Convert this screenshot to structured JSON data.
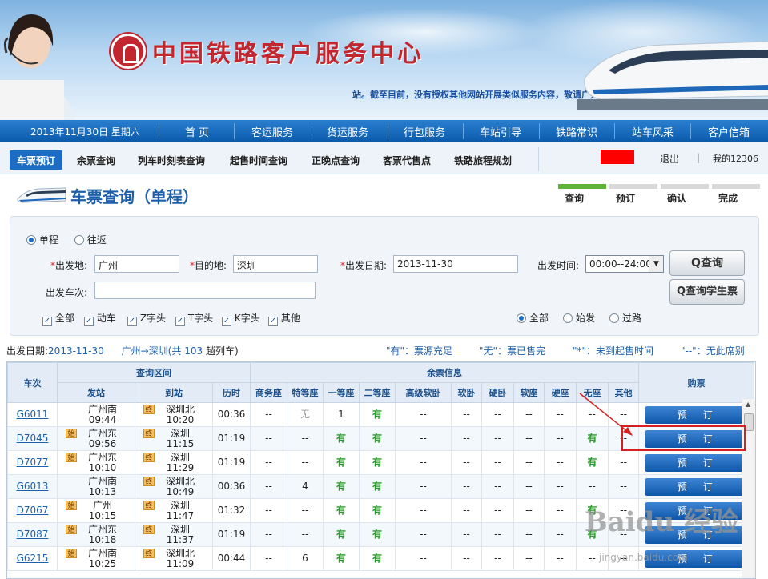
{
  "banner": {
    "title": "中国铁路客户服务中心",
    "note": "站。截至目前，没有授权其他网站开展类似服务内容，敬请广大用户注意"
  },
  "nav": {
    "date": "2013年11月30日 星期六",
    "items": [
      "首 页",
      "客运服务",
      "货运服务",
      "行包服务",
      "车站引导",
      "铁路常识",
      "站车风采",
      "客户信箱"
    ]
  },
  "subnav": {
    "tabs": [
      "车票预订",
      "余票查询",
      "列车时刻表查询",
      "起售时间查询",
      "正晚点查询",
      "客票代售点",
      "铁路旅程规划"
    ],
    "logout": "退出",
    "sep": "|",
    "my": "我的12306"
  },
  "page": {
    "title": "车票查询（单程）",
    "steps": [
      "查询",
      "预订",
      "确认",
      "完成"
    ]
  },
  "form": {
    "trip_oneway": "单程",
    "trip_round": "往返",
    "from_label": "出发地:",
    "from_value": "广州",
    "to_label": "目的地:",
    "to_value": "深圳",
    "date_label": "出发日期:",
    "date_value": "2013-11-30",
    "time_label": "出发时间:",
    "time_value": "00:00--24:00",
    "train_label": "出发车次:",
    "train_value": "",
    "req_mark": "*",
    "check_mark": "✓",
    "types": [
      "全部",
      "动车",
      "Z字头",
      "T字头",
      "K字头",
      "其他"
    ],
    "station_filter": [
      "全部",
      "始发",
      "过路"
    ],
    "query_btn": "查询",
    "student_btn": "查询学生票",
    "search_glyph": "Q"
  },
  "summary": {
    "label": "出发日期:",
    "date": "2013-11-30",
    "route": "广州→深圳(共",
    "count": "103",
    "unit": "趟列车)",
    "legend_you": "\"有\"：票源充足",
    "legend_wu": "\"无\"：票已售完",
    "legend_star": "\"*\"：未到起售时间",
    "legend_dash": "\"--\"：无此席别"
  },
  "table": {
    "headers": {
      "train": "车次",
      "range": "查询区间",
      "from": "发站",
      "to": "到站",
      "duration": "历时",
      "seats_group": "余票信息",
      "buy": "购票"
    },
    "seat_types": [
      "商务座",
      "特等座",
      "一等座",
      "二等座",
      "高级软卧",
      "软卧",
      "硬卧",
      "软座",
      "硬座",
      "无座",
      "其他"
    ],
    "book_label": "预订",
    "rows": [
      {
        "no": "G6011",
        "from": "广州南",
        "dep": "09:44",
        "from_start": false,
        "to": "深圳北",
        "arr": "10:20",
        "dur": "00:36",
        "seats": [
          "--",
          "无",
          "1",
          "有",
          "--",
          "--",
          "--",
          "--",
          "--",
          "--",
          "--"
        ]
      },
      {
        "no": "D7045",
        "from": "广州东",
        "dep": "09:56",
        "from_start": true,
        "to": "深圳",
        "arr": "11:15",
        "dur": "01:19",
        "seats": [
          "--",
          "--",
          "有",
          "有",
          "--",
          "--",
          "--",
          "--",
          "--",
          "有",
          "--"
        ]
      },
      {
        "no": "D7077",
        "from": "广州东",
        "dep": "10:10",
        "from_start": true,
        "to": "深圳",
        "arr": "11:29",
        "dur": "01:19",
        "seats": [
          "--",
          "--",
          "有",
          "有",
          "--",
          "--",
          "--",
          "--",
          "--",
          "有",
          "--"
        ]
      },
      {
        "no": "G6013",
        "from": "广州南",
        "dep": "10:13",
        "from_start": false,
        "to": "深圳北",
        "arr": "10:49",
        "dur": "00:36",
        "seats": [
          "--",
          "4",
          "有",
          "有",
          "--",
          "--",
          "--",
          "--",
          "--",
          "--",
          "--"
        ]
      },
      {
        "no": "D7067",
        "from": "广州",
        "dep": "10:15",
        "from_start": true,
        "to": "深圳",
        "arr": "11:47",
        "dur": "01:32",
        "seats": [
          "--",
          "--",
          "有",
          "有",
          "--",
          "--",
          "--",
          "--",
          "--",
          "有",
          "--"
        ]
      },
      {
        "no": "D7087",
        "from": "广州东",
        "dep": "10:18",
        "from_start": true,
        "to": "深圳",
        "arr": "11:37",
        "dur": "01:19",
        "seats": [
          "--",
          "--",
          "有",
          "有",
          "--",
          "--",
          "--",
          "--",
          "--",
          "有",
          "--"
        ]
      },
      {
        "no": "G6215",
        "from": "广州南",
        "dep": "10:25",
        "from_start": true,
        "to": "深圳北",
        "arr": "11:09",
        "dur": "00:44",
        "seats": [
          "--",
          "6",
          "有",
          "有",
          "--",
          "--",
          "--",
          "--",
          "--",
          "--",
          "--"
        ]
      }
    ],
    "start_badge": "始",
    "end_badge": "终"
  },
  "watermark": {
    "text": "Baidu 经验",
    "sub": "jingyan.baidu.com"
  },
  "colors": {
    "brand_red": "#c2262e",
    "nav_blue": "#0a5aab",
    "available_green": "#2a9a2a",
    "highlight_red": "#d42020"
  }
}
